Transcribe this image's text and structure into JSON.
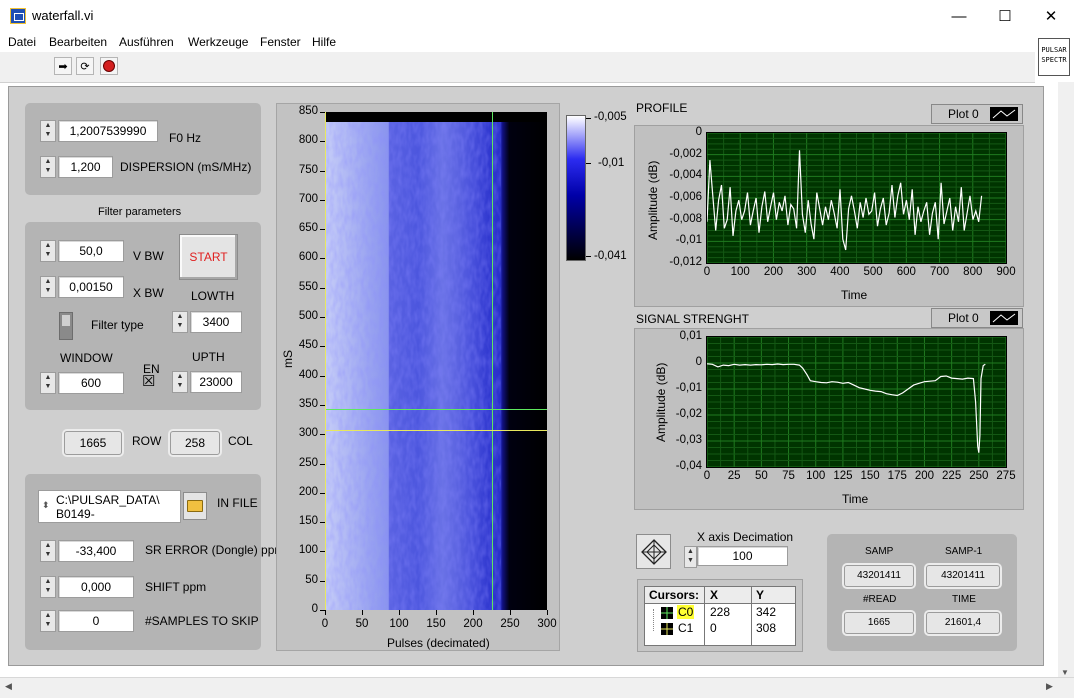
{
  "window": {
    "title": "waterfall.vi",
    "minimize_glyph": "—",
    "maximize_glyph": "☐",
    "close_glyph": "✕"
  },
  "menu": [
    "Datei",
    "Bearbeiten",
    "Ausführen",
    "Werkzeuge",
    "Fenster",
    "Hilfe"
  ],
  "toolbar": {
    "icons": [
      "run-arrow-icon",
      "run-continuously-icon",
      "abort-icon"
    ],
    "run_glyph": "➡",
    "continuous_glyph": "⟳",
    "badge_line1": "PULSAR",
    "badge_line2": "SPECTR"
  },
  "params": {
    "f0_value": "1,2007539990",
    "f0_label": "F0 Hz",
    "dispersion_value": "1,200",
    "dispersion_label": "DISPERSION (mS/MHz)"
  },
  "filter": {
    "heading": "Filter parameters",
    "vbw_value": "50,0",
    "vbw_label": "V BW",
    "xbw_value": "0,00150",
    "xbw_label": "X BW",
    "start_label": "START",
    "lowth_label": "LOWTH",
    "lowth_value": "3400",
    "filter_type_label": "Filter type",
    "window_label": "WINDOW",
    "window_value": "600",
    "en_label": "EN",
    "en_checked": true,
    "en_mark": "☒",
    "upth_label": "UPTH",
    "upth_value": "23000"
  },
  "rowcol": {
    "row_value": "1665",
    "row_label": "ROW",
    "col_value": "258",
    "col_label": "COL"
  },
  "file": {
    "path_line1": "C:\\PULSAR_DATA\\",
    "path_line2": "B0149-",
    "label": "IN FILE",
    "sr_error_value": "-33,400",
    "sr_error_label": "SR ERROR (Dongle) ppm",
    "shift_value": "0,000",
    "shift_label": "SHIFT ppm",
    "skip_value": "0",
    "skip_label": "#SAMPLES TO SKIP"
  },
  "waterfall": {
    "ylabel": "mS",
    "xlabel": "Pulses (decimated)",
    "yticks": [
      "850",
      "800",
      "750",
      "700",
      "650",
      "600",
      "550",
      "500",
      "450",
      "400",
      "350",
      "300",
      "250",
      "200",
      "150",
      "100",
      "50",
      "0"
    ],
    "xticks": [
      "0",
      "50",
      "100",
      "150",
      "200",
      "250",
      "300"
    ],
    "colorbar_ticks": [
      "-0,005",
      "-0,01",
      "-0,041"
    ],
    "cursor_colors": {
      "c0": "#5ee85e",
      "c1": "#e8e85e"
    }
  },
  "profile": {
    "title": "PROFILE",
    "legend": "Plot 0"
  },
  "signal": {
    "title": "SIGNAL STRENGHT",
    "legend": "Plot 0"
  },
  "decimation": {
    "label": "X axis Decimation",
    "value": "100"
  },
  "cursors": {
    "headers": [
      "Cursors:",
      "X",
      "Y"
    ],
    "rows": [
      {
        "name": "C0",
        "x": "228",
        "y": "342"
      },
      {
        "name": "C1",
        "x": "0",
        "y": "308"
      }
    ]
  },
  "indicators": {
    "samp_label": "SAMP",
    "samp_value": "43201411",
    "samp1_label": "SAMP-1",
    "samp1_value": "43201411",
    "read_label": "#READ",
    "read_value": "1665",
    "time_label": "TIME",
    "time_value": "21601,4"
  },
  "colors": {
    "panel": "#cfcfcf",
    "graph_bg": "#003400",
    "trace": "#ffffff",
    "start_text": "#e02020",
    "cursor0_highlight": "#ffff33"
  },
  "chart_data": [
    {
      "type": "line",
      "name": "PROFILE",
      "title": "PROFILE",
      "xlabel": "Time",
      "ylabel": "Amplitude (dB)",
      "legend": [
        "Plot 0"
      ],
      "xlim": [
        0,
        900
      ],
      "ylim": [
        -0.012,
        0
      ],
      "xticks": [
        "0",
        "100",
        "200",
        "300",
        "400",
        "500",
        "600",
        "700",
        "800",
        "900"
      ],
      "yticks": [
        "0",
        "-0,002",
        "-0,004",
        "-0,006",
        "-0,008",
        "-0,01",
        "-0,012"
      ],
      "grid": true,
      "series": [
        {
          "values": [
            -0.0082,
            -0.0025,
            -0.0058,
            -0.009,
            -0.0062,
            -0.0048,
            -0.0088,
            -0.008,
            -0.005,
            -0.0095,
            -0.0072,
            -0.0062,
            -0.008,
            -0.0072,
            -0.0055,
            -0.0085,
            -0.0072,
            -0.006,
            -0.0092,
            -0.0068,
            -0.0054,
            -0.0082,
            -0.0068,
            -0.0055,
            -0.008,
            -0.0064,
            -0.0072,
            -0.0058,
            -0.0085,
            -0.0066,
            -0.007,
            -0.0088,
            -0.0016,
            -0.0075,
            -0.0092,
            -0.0062,
            -0.0084,
            -0.0098,
            -0.0055,
            -0.007,
            -0.0085,
            -0.0068,
            -0.008,
            -0.0062,
            -0.0074,
            -0.0088,
            -0.0052,
            -0.0098,
            -0.0108,
            -0.007,
            -0.0058,
            -0.0072,
            -0.0088,
            -0.0064,
            -0.0078,
            -0.006,
            -0.0075,
            -0.0072,
            -0.0055,
            -0.0086,
            -0.007,
            -0.006,
            -0.0085,
            -0.0074,
            -0.0048,
            -0.0078,
            -0.0058,
            -0.0046,
            -0.0075,
            -0.0062,
            -0.008,
            -0.0052,
            -0.0094,
            -0.0068,
            -0.0082,
            -0.0072,
            -0.0064,
            -0.0094,
            -0.0074,
            -0.0064,
            -0.0098,
            -0.0046,
            -0.0084,
            -0.0072,
            -0.006,
            -0.009,
            -0.0068,
            -0.0082,
            -0.005,
            -0.009,
            -0.0074,
            -0.0058,
            -0.008,
            -0.0072,
            -0.0082,
            -0.0058
          ],
          "x_start": 0,
          "x_step": 8.7
        }
      ]
    },
    {
      "type": "line",
      "name": "SIGNAL STRENGHT",
      "title": "SIGNAL STRENGHT",
      "xlabel": "Time",
      "ylabel": "Amplitude (dB)",
      "legend": [
        "Plot 0"
      ],
      "xlim": [
        0,
        275
      ],
      "ylim": [
        -0.04,
        0.01
      ],
      "xticks": [
        "0",
        "25",
        "50",
        "75",
        "100",
        "125",
        "150",
        "175",
        "200",
        "225",
        "250",
        "275"
      ],
      "yticks": [
        "0,01",
        "0",
        "-0,01",
        "-0,02",
        "-0,03",
        "-0,04"
      ],
      "grid": true,
      "x": [
        0,
        5,
        10,
        15,
        20,
        25,
        30,
        35,
        40,
        45,
        50,
        55,
        60,
        65,
        70,
        75,
        80,
        85,
        88,
        92,
        95,
        100,
        105,
        110,
        115,
        120,
        125,
        130,
        135,
        140,
        145,
        150,
        155,
        160,
        165,
        170,
        175,
        180,
        185,
        190,
        195,
        200,
        205,
        210,
        215,
        220,
        225,
        230,
        235,
        240,
        245,
        247,
        249,
        250,
        251,
        252,
        254,
        256
      ],
      "y": [
        -0.0003,
        -0.0005,
        -0.0015,
        -0.0008,
        -0.001,
        -0.0005,
        -0.0008,
        -0.0006,
        -0.0008,
        -0.0006,
        -0.0007,
        -0.0005,
        -0.0006,
        -0.0004,
        -0.0006,
        -0.0005,
        -0.0005,
        -0.0008,
        -0.002,
        -0.0045,
        -0.0068,
        -0.0072,
        -0.0075,
        -0.0076,
        -0.0072,
        -0.0074,
        -0.0078,
        -0.0075,
        -0.0085,
        -0.0095,
        -0.01,
        -0.0105,
        -0.0108,
        -0.011,
        -0.0118,
        -0.0122,
        -0.0125,
        -0.0115,
        -0.01,
        -0.0085,
        -0.0078,
        -0.0072,
        -0.007,
        -0.0068,
        -0.0052,
        -0.005,
        -0.0058,
        -0.006,
        -0.0062,
        -0.0058,
        -0.006,
        -0.015,
        -0.032,
        -0.0345,
        -0.028,
        -0.006,
        -0.001,
        -0.0005
      ]
    }
  ]
}
